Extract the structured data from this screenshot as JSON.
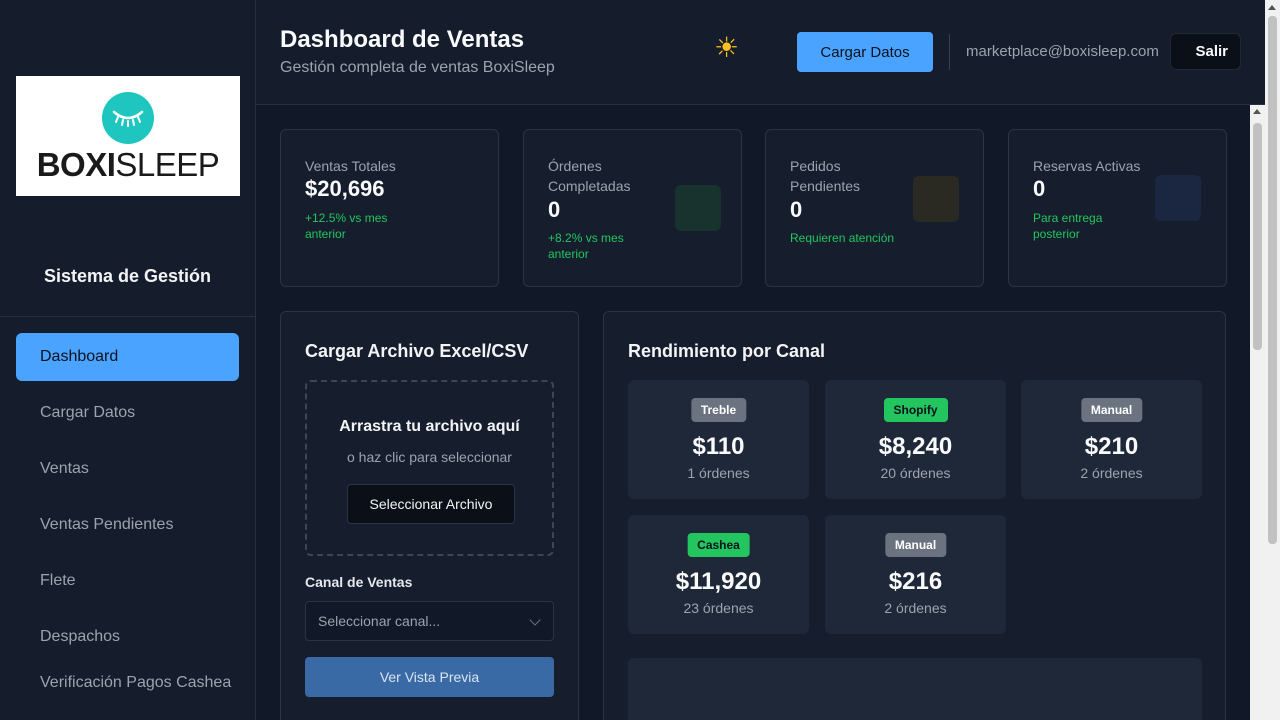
{
  "sidebar": {
    "logo": {
      "text_bold": "BOXI",
      "text_light": "SLEEP"
    },
    "system_title": "Sistema de Gestión",
    "items": [
      {
        "label": "Dashboard",
        "active": true
      },
      {
        "label": "Cargar Datos"
      },
      {
        "label": "Ventas"
      },
      {
        "label": "Ventas Pendientes"
      },
      {
        "label": "Flete"
      },
      {
        "label": "Despachos"
      },
      {
        "label": "Verificación Pagos Cashea"
      }
    ]
  },
  "header": {
    "title": "Dashboard de Ventas",
    "subtitle": "Gestión completa de ventas BoxiSleep",
    "theme_icon": "sun-icon",
    "upload_button": "Cargar Datos",
    "email": "marketplace@boxisleep.com",
    "logout_button": "Salir"
  },
  "stats": [
    {
      "label": "Ventas Totales",
      "value": "$20,696",
      "note": "+12.5% vs mes anterior",
      "color": "#22c55e"
    },
    {
      "label": "Órdenes Completadas",
      "value": "0",
      "note": "+8.2% vs mes anterior",
      "color": "#22c55e",
      "icon_bg": "#18322e"
    },
    {
      "label": "Pedidos Pendientes",
      "value": "0",
      "note": "Requieren atención",
      "color": "#22c55e",
      "icon_bg": "#2b2a22"
    },
    {
      "label": "Reservas Activas",
      "value": "0",
      "note": "Para entrega posterior",
      "color": "#22c55e",
      "icon_bg": "#1b2640"
    }
  ],
  "upload": {
    "title": "Cargar Archivo Excel/CSV",
    "drop_title": "Arrastra tu archivo aquí",
    "drop_sub": "o haz clic para seleccionar",
    "select_button": "Seleccionar Archivo",
    "channel_label": "Canal de Ventas",
    "channel_placeholder": "Seleccionar canal...",
    "preview_button": "Ver Vista Previa"
  },
  "channels": {
    "title": "Rendimiento por Canal",
    "items": [
      {
        "name": "Treble",
        "value": "$110",
        "orders": "1 órdenes",
        "badge_bg": "#6b7280",
        "badge_fg": "#ffffff"
      },
      {
        "name": "Shopify",
        "value": "$8,240",
        "orders": "20 órdenes",
        "badge_bg": "#22c55e",
        "badge_fg": "#0b1220"
      },
      {
        "name": "Manual",
        "value": "$210",
        "orders": "2 órdenes",
        "badge_bg": "#6b7280",
        "badge_fg": "#ffffff"
      },
      {
        "name": "Cashea",
        "value": "$11,920",
        "orders": "23 órdenes",
        "badge_bg": "#22c55e",
        "badge_fg": "#0b1220"
      },
      {
        "name": "Manual",
        "value": "$216",
        "orders": "2 órdenes",
        "badge_bg": "#6b7280",
        "badge_fg": "#ffffff"
      }
    ]
  }
}
